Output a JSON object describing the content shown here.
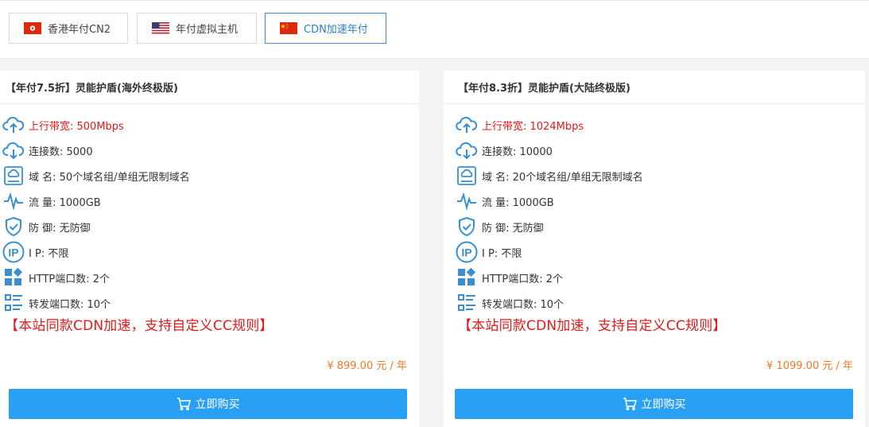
{
  "tabs": [
    {
      "label": "香港年付CN2",
      "flag": "hk-flag-icon",
      "active": false
    },
    {
      "label": "年付虚拟主机",
      "flag": "us-flag-icon",
      "active": false
    },
    {
      "label": "CDN加速年付",
      "flag": "cn-flag-icon",
      "active": true
    }
  ],
  "colors": {
    "accent": "#2aa0f5",
    "promo": "#e21a1a",
    "price": "#f07a29",
    "icon": "#3b8fd1"
  },
  "products": [
    {
      "title": "【年付7.5折】灵能护盾(海外终极版)",
      "features": [
        {
          "icon": "cloud-upload-icon",
          "text": "上行带宽: 500Mbps",
          "highlight": true
        },
        {
          "icon": "cloud-download-icon",
          "text": "连接数: 5000"
        },
        {
          "icon": "domain-icon",
          "text": "域 名: 50个域名组/单组无限制域名"
        },
        {
          "icon": "traffic-icon",
          "text": "流 量:  1000GB"
        },
        {
          "icon": "shield-check-icon",
          "text": "防 御: 无防御"
        },
        {
          "icon": "ip-icon",
          "text": "I P: 不限"
        },
        {
          "icon": "apps-icon",
          "text": "HTTP端口数: 2个"
        },
        {
          "icon": "list-icon",
          "text": "转发端口数: 10个"
        }
      ],
      "promo": "【本站同款CDN加速，支持自定义CC规则】",
      "price": "¥ 899.00 元 / 年",
      "buy_label": "立即购买"
    },
    {
      "title": "【年付8.3折】灵能护盾(大陆终极版)",
      "features": [
        {
          "icon": "cloud-upload-icon",
          "text": "上行带宽: 1024Mbps",
          "highlight": true
        },
        {
          "icon": "cloud-download-icon",
          "text": "连接数: 10000"
        },
        {
          "icon": "domain-icon",
          "text": "域 名: 20个域名组/单组无限制域名"
        },
        {
          "icon": "traffic-icon",
          "text": "流 量:  1000GB"
        },
        {
          "icon": "shield-check-icon",
          "text": "防 御: 无防御"
        },
        {
          "icon": "ip-icon",
          "text": "I P: 不限"
        },
        {
          "icon": "apps-icon",
          "text": "HTTP端口数: 2个"
        },
        {
          "icon": "list-icon",
          "text": "转发端口数: 10个"
        }
      ],
      "promo": "【本站同款CDN加速，支持自定义CC规则】",
      "price": "¥ 1099.00 元 / 年",
      "buy_label": "立即购买"
    }
  ]
}
